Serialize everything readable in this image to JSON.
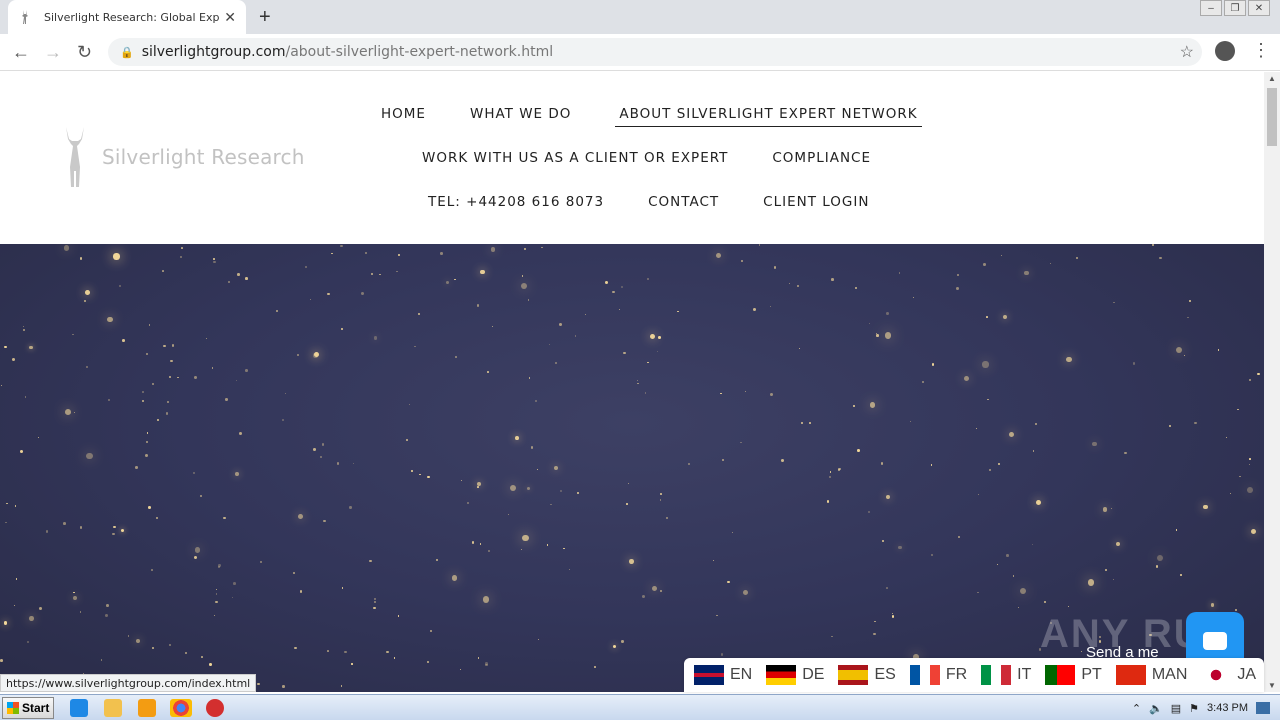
{
  "browser": {
    "tab_title": "Silverlight Research: Global Expert N",
    "url_host": "silverlightgroup.com",
    "url_path": "/about-silverlight-expert-network.html",
    "status_url": "https://www.silverlightgroup.com/index.html"
  },
  "site": {
    "logo_text": "Silverlight Research",
    "nav_row1": [
      "HOME",
      "WHAT WE DO",
      "ABOUT SILVERLIGHT EXPERT NETWORK"
    ],
    "nav_row2": [
      "WORK WITH US AS A CLIENT OR EXPERT",
      "COMPLIANCE"
    ],
    "nav_row3": [
      "TEL: +44208 616 8073",
      "CONTACT",
      "CLIENT LOGIN"
    ],
    "active_nav": "ABOUT SILVERLIGHT EXPERT NETWORK"
  },
  "languages": [
    {
      "code": "EN",
      "colors": [
        "#012169",
        "#ffffff",
        "#c8102e"
      ]
    },
    {
      "code": "DE",
      "colors": [
        "#000000",
        "#dd0000",
        "#ffce00"
      ]
    },
    {
      "code": "ES",
      "colors": [
        "#aa151b",
        "#f1bf00",
        "#aa151b"
      ]
    },
    {
      "code": "FR",
      "colors": [
        "#0055a4",
        "#ffffff",
        "#ef4135"
      ]
    },
    {
      "code": "IT",
      "colors": [
        "#009246",
        "#ffffff",
        "#ce2b37"
      ]
    },
    {
      "code": "PT",
      "colors": [
        "#006600",
        "#ff0000",
        "#ff0000"
      ]
    },
    {
      "code": "MAN",
      "colors": [
        "#de2910",
        "#de2910",
        "#de2910"
      ]
    },
    {
      "code": "JA",
      "colors": [
        "#ffffff",
        "#bc002d",
        "#ffffff"
      ]
    }
  ],
  "chat": {
    "label": "Send a me",
    "watermark": "ANY RUN"
  },
  "taskbar": {
    "start": "Start",
    "time": "3:43 PM"
  }
}
